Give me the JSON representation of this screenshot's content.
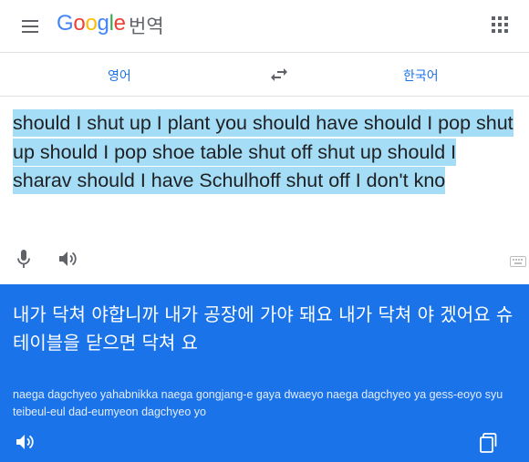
{
  "header": {
    "logo": {
      "G": "G",
      "o1": "o",
      "o2": "o",
      "g": "g",
      "l": "l",
      "e": "e"
    },
    "app_name": "번역",
    "menu_icon": "hamburger-menu-icon",
    "apps_icon": "apps-grid-icon"
  },
  "languages": {
    "source": "영어",
    "target": "한국어",
    "swap_icon": "swap-arrows-icon"
  },
  "source": {
    "text": "should I shut up I plant you should have should I pop shut up should I pop shoe table shut off shut up should I sharav should I have Schulhoff shut off I don't kno",
    "highlight_color": "#a4ddf5",
    "icons": [
      "microphone-icon",
      "speaker-icon",
      "keyboard-icon"
    ]
  },
  "result": {
    "translation": "내가 닥쳐 야합니까 내가 공장에 가야 돼요 내가 닥쳐 야 겠어요 슈 테이블을 닫으면 닥쳐 요",
    "romanization": "naega dagchyeo yahabnikka naega gongjang-e gaya dwaeyo naega dagchyeo ya gess-eoyo syu teibeul-eul dad-eumyeon dagchyeo yo",
    "background_color": "#1a73e8",
    "icons": [
      "speaker-icon",
      "copy-icon"
    ]
  }
}
